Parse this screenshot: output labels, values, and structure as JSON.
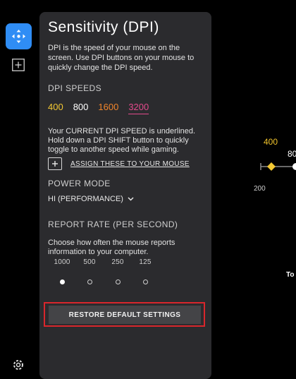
{
  "rail": {
    "active_icon": "move-arrows-icon",
    "add_icon": "plus-square-icon",
    "settings_icon": "gear-icon"
  },
  "panel": {
    "title": "Sensitivity (DPI)",
    "description": "DPI is the speed of your mouse on the screen. Use DPI buttons on your mouse to quickly change the DPI speed.",
    "dpi_speeds_label": "DPI SPEEDS",
    "dpi_speeds": [
      {
        "value": "400",
        "color": "#f3c833"
      },
      {
        "value": "800",
        "color": "#ffffff"
      },
      {
        "value": "1600",
        "color": "#f0852b"
      },
      {
        "value": "3200",
        "color": "#e34a8c",
        "current": true
      }
    ],
    "current_note": "Your CURRENT DPI SPEED is underlined. Hold down a DPI SHIFT button to quickly toggle to another speed while gaming.",
    "assign_label": "ASSIGN THESE TO YOUR MOUSE",
    "power_mode_label": "POWER MODE",
    "power_mode_value": "HI (PERFORMANCE)",
    "report_rate_label": "REPORT RATE (PER SECOND)",
    "report_rate_desc": "Choose how often the mouse reports information to your computer.",
    "report_rates": [
      {
        "value": "1000",
        "selected": true
      },
      {
        "value": "500",
        "selected": false
      },
      {
        "value": "250",
        "selected": false
      },
      {
        "value": "125",
        "selected": false
      }
    ],
    "restore_label": "RESTORE DEFAULT SETTINGS"
  },
  "right": {
    "marker_400": "400",
    "marker_800": "80",
    "axis_200": "200",
    "text_to": "To"
  },
  "colors": {
    "accent_blue": "#2f8df5",
    "highlight_red": "#d9262c",
    "dpi_yellow": "#f3c833"
  }
}
